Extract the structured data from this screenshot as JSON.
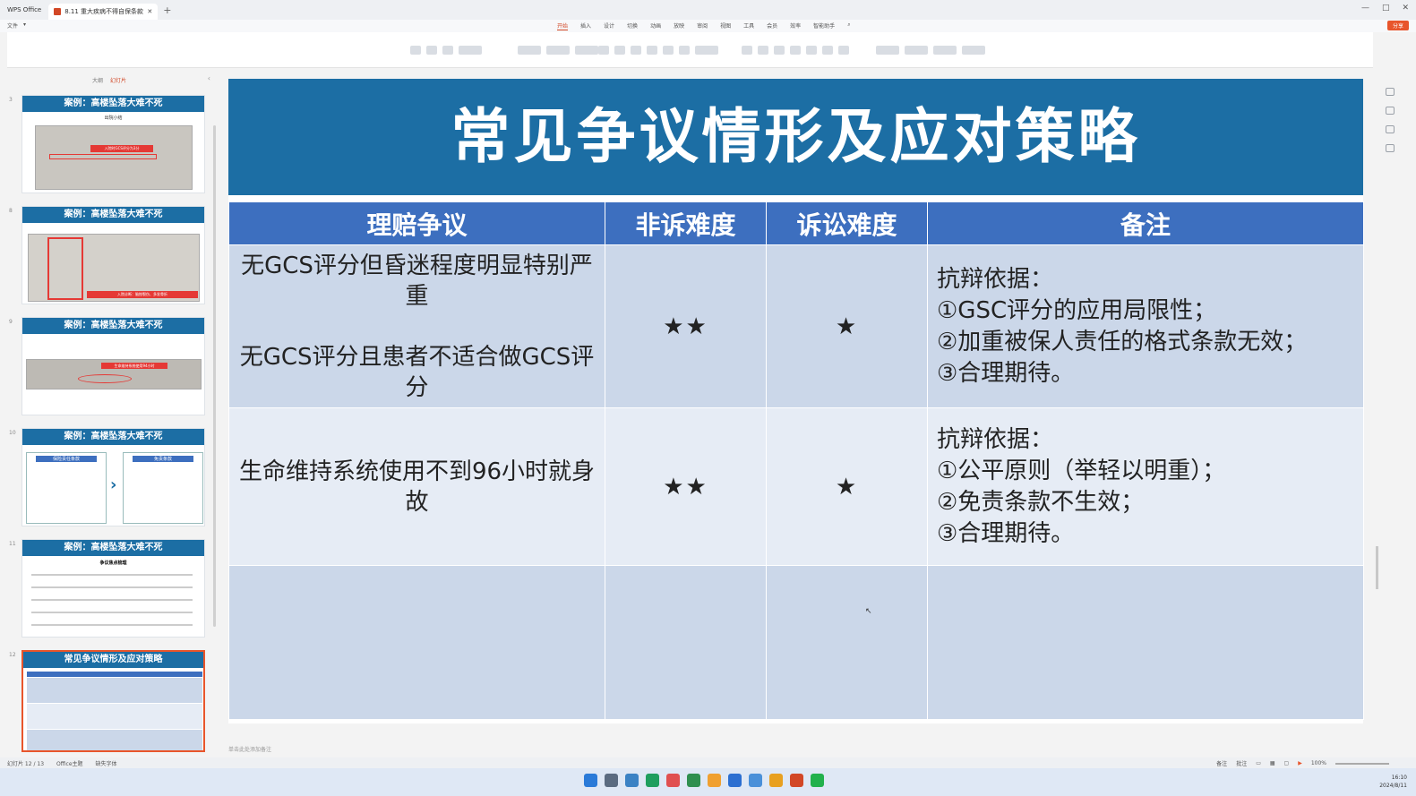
{
  "titlebar": {
    "app_tab": "WPS Office",
    "doc_tab": "8.11 重大疾病不得自保条款的...",
    "new_tab": "+",
    "window_controls": [
      "—",
      "□",
      "✕"
    ]
  },
  "menubar": {
    "file_menu": [
      "文件",
      "▾"
    ],
    "tabs": [
      "开始",
      "插入",
      "设计",
      "切换",
      "动画",
      "放映",
      "审阅",
      "视图",
      "工具",
      "会员",
      "效率",
      "智能助手"
    ],
    "active_tab": "开始",
    "share": "分享"
  },
  "left_panel": {
    "header": [
      "大纲",
      "幻灯片"
    ],
    "thumbnails": [
      {
        "num": "3",
        "title": "案例：高楼坠落大难不死",
        "sub": "出院小结",
        "highlight": "入院时GCS评分为3分"
      },
      {
        "num": "8",
        "title": "案例：高楼坠落大难不死",
        "highlight": "入院诊断：脑挫裂伤、多发骨折"
      },
      {
        "num": "9",
        "title": "案例：高楼坠落大难不死",
        "highlight": "生命维持系统使用94小时"
      },
      {
        "num": "10",
        "title": "案例：高楼坠落大难不死",
        "left_box": "保险责任条款",
        "right_box": "免责条款"
      },
      {
        "num": "11",
        "title": "案例：高楼坠落大难不死",
        "sub": "争议焦点梳理"
      },
      {
        "num": "12",
        "title": "常见争议情形及应对策略"
      }
    ]
  },
  "slide": {
    "title": "常见争议情形及应对策略",
    "headers": [
      "理赔争议",
      "非诉难度",
      "诉讼难度",
      "备注"
    ],
    "rows": [
      {
        "issue_a": "无GCS评分但昏迷程度明显特别严重",
        "issue_b": "无GCS评分且患者不适合做GCS评分",
        "non_litigation": "★★",
        "litigation": "★",
        "note_title": "抗辩依据：",
        "notes": [
          "①GSC评分的应用局限性；",
          "②加重被保人责任的格式条款无效；",
          "③合理期待。"
        ]
      },
      {
        "issue_a": "生命维持系统使用不到96小时就身故",
        "non_litigation": "★★",
        "litigation": "★",
        "note_title": "抗辩依据：",
        "notes": [
          "①公平原则（举轻以明重）；",
          "②免责条款不生效；",
          "③合理期待。"
        ]
      }
    ]
  },
  "notes_placeholder": "单击此处添加备注",
  "statusbar": {
    "slide_count": "幻灯片 12 / 13",
    "theme": "Office主题",
    "font_missing": "缺失字体",
    "right": [
      "备注",
      "批注"
    ],
    "zoom": "100%"
  },
  "taskbar": {
    "time": "16:10",
    "date": "2024/8/11"
  }
}
